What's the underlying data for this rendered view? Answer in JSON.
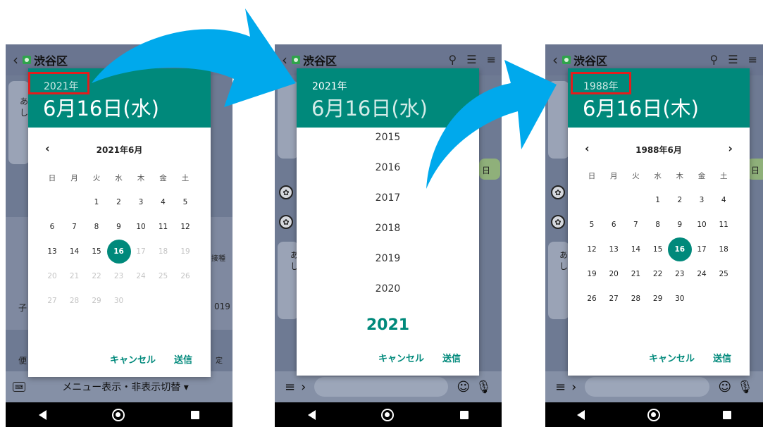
{
  "arrow_color": "#00a9ec",
  "accent_color": "#00897b",
  "highlight_color": "#e11d1d",
  "phones": [
    {
      "appbar": {
        "title": "渋谷区"
      },
      "bg_texts": [
        "あ",
        "し",
        "子",
        "接種",
        "019",
        "便",
        "定"
      ],
      "input_bar": {
        "menu_text": "メニュー表示・非表示切替 ▾"
      },
      "dialog": {
        "header_year": "2021年",
        "header_date": "6月16日(水)",
        "month_title": "2021年6月",
        "weekdays": [
          "日",
          "月",
          "火",
          "水",
          "木",
          "金",
          "土"
        ],
        "weeks": [
          [
            "",
            "",
            "1",
            "2",
            "3",
            "4",
            "5"
          ],
          [
            "6",
            "7",
            "8",
            "9",
            "10",
            "11",
            "12"
          ],
          [
            "13",
            "14",
            "15",
            "16",
            "17",
            "18",
            "19"
          ],
          [
            "20",
            "21",
            "22",
            "23",
            "24",
            "25",
            "26"
          ],
          [
            "27",
            "28",
            "29",
            "30",
            "",
            "",
            ""
          ]
        ],
        "selected_day": "16",
        "cancel_label": "キャンセル",
        "ok_label": "送信"
      }
    },
    {
      "appbar": {
        "title": "渋谷区"
      },
      "bg_texts": [
        "あ",
        "し",
        "日"
      ],
      "dialog": {
        "header_year": "2021年",
        "header_date": "6月16日(水)",
        "years": [
          "2015",
          "2016",
          "2017",
          "2018",
          "2019",
          "2020",
          "2021"
        ],
        "selected_year": "2021",
        "cancel_label": "キャンセル",
        "ok_label": "送信"
      }
    },
    {
      "appbar": {
        "title": "渋谷区"
      },
      "bg_texts": [
        "あ",
        "し",
        "日"
      ],
      "dialog": {
        "header_year": "1988年",
        "header_date": "6月16日(木)",
        "month_title": "1988年6月",
        "weekdays": [
          "日",
          "月",
          "火",
          "水",
          "木",
          "金",
          "土"
        ],
        "weeks": [
          [
            "",
            "",
            "",
            "1",
            "2",
            "3",
            "4"
          ],
          [
            "5",
            "6",
            "7",
            "8",
            "9",
            "10",
            "11"
          ],
          [
            "12",
            "13",
            "14",
            "15",
            "16",
            "17",
            "18"
          ],
          [
            "19",
            "20",
            "21",
            "22",
            "23",
            "24",
            "25"
          ],
          [
            "26",
            "27",
            "28",
            "29",
            "30",
            "",
            ""
          ]
        ],
        "selected_day": "16",
        "cancel_label": "キャンセル",
        "ok_label": "送信"
      }
    }
  ]
}
